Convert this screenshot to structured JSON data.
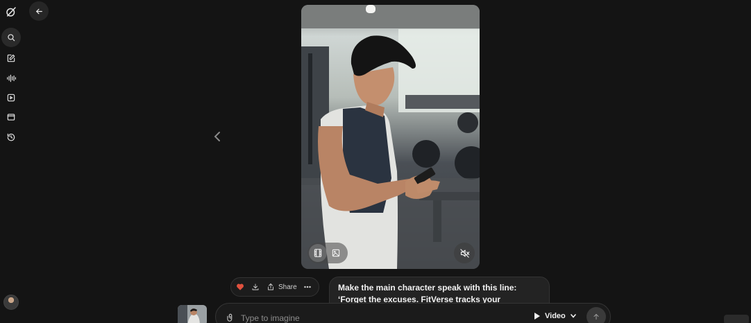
{
  "sidebar": {
    "items": [
      {
        "icon": "search-icon"
      },
      {
        "icon": "edit-icon"
      },
      {
        "icon": "waveform-icon"
      },
      {
        "icon": "media-icon"
      },
      {
        "icon": "folder-icon"
      },
      {
        "icon": "history-icon"
      }
    ]
  },
  "media": {
    "modes": [
      {
        "icon": "video-mode-icon",
        "active": true
      },
      {
        "icon": "image-mode-icon",
        "active": false
      }
    ],
    "muted": true
  },
  "actions": {
    "liked": true,
    "share_label": "Share"
  },
  "prompt": {
    "line1": "Make the main character speak with this line:",
    "line2": "‘Forget the excuses. FitVerse tracks your"
  },
  "composer": {
    "placeholder": "Type to imagine",
    "mode_label": "Video"
  },
  "colors": {
    "background": "#141414",
    "like": "#e0513e"
  }
}
